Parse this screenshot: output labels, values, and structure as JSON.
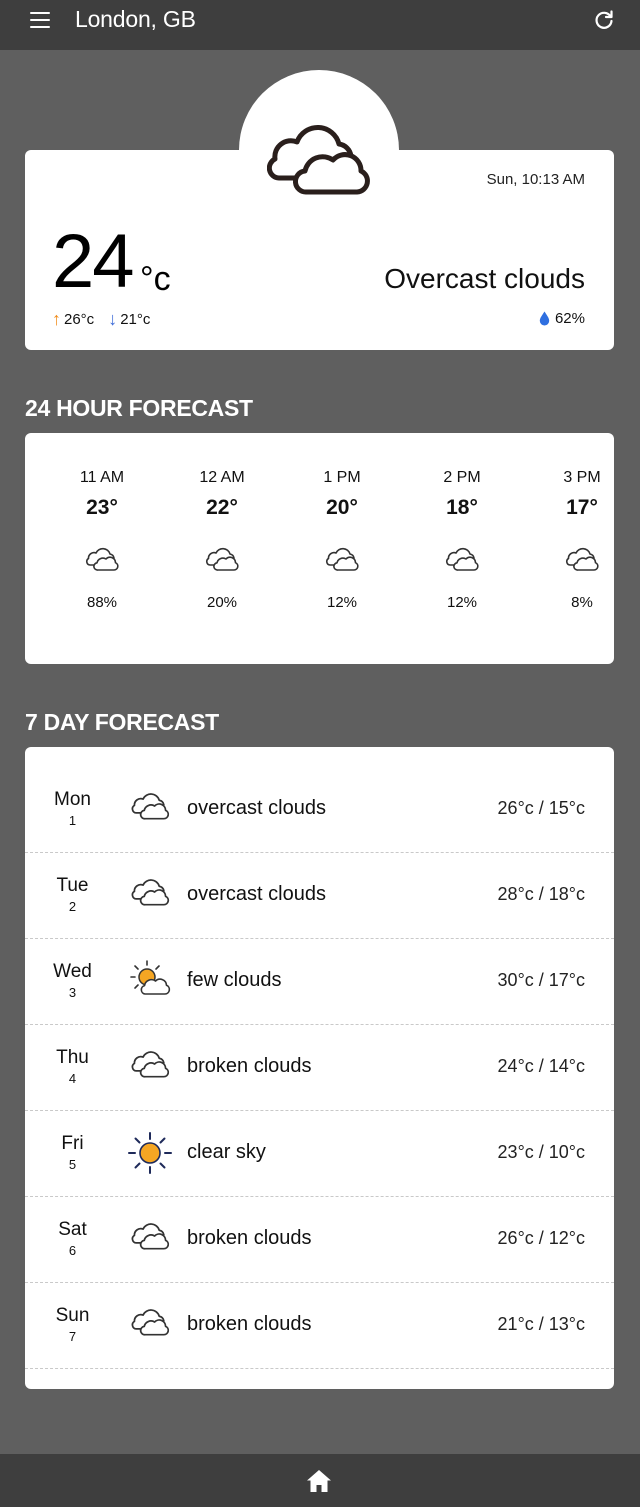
{
  "header": {
    "city": "London, GB",
    "menu_icon": "hamburger-menu-icon",
    "refresh_icon": "refresh-icon"
  },
  "current": {
    "icon": "overcast-clouds-icon",
    "datetime": "Sun, 10:13 AM",
    "temp": "24",
    "unit": "°c",
    "high": "26°c",
    "low": "21°c",
    "description": "Overcast clouds",
    "humidity": "62%",
    "colors": {
      "high_arrow": "#f08c1a",
      "low_arrow": "#3c6bd8",
      "humidity_drop": "#2f6fe0"
    }
  },
  "hourly": {
    "title": "24 HOUR FORECAST",
    "items": [
      {
        "time": "11 AM",
        "temp": "23°",
        "icon": "cloud-icon",
        "pop": "88%"
      },
      {
        "time": "12 AM",
        "temp": "22°",
        "icon": "cloud-icon",
        "pop": "20%"
      },
      {
        "time": "1 PM",
        "temp": "20°",
        "icon": "cloud-icon",
        "pop": "12%"
      },
      {
        "time": "2 PM",
        "temp": "18°",
        "icon": "cloud-icon",
        "pop": "12%"
      },
      {
        "time": "3 PM",
        "temp": "17°",
        "icon": "cloud-icon",
        "pop": "8%"
      }
    ]
  },
  "daily": {
    "title": "7 DAY FORECAST",
    "items": [
      {
        "day": "Mon",
        "date": "1",
        "icon": "cloud-icon",
        "desc": "overcast clouds",
        "range": "26°c / 15°c"
      },
      {
        "day": "Tue",
        "date": "2",
        "icon": "cloud-icon",
        "desc": "overcast clouds",
        "range": "28°c / 18°c"
      },
      {
        "day": "Wed",
        "date": "3",
        "icon": "sun-cloud-icon",
        "desc": "few clouds",
        "range": "30°c / 17°c"
      },
      {
        "day": "Thu",
        "date": "4",
        "icon": "cloud-icon",
        "desc": "broken clouds",
        "range": "24°c / 14°c"
      },
      {
        "day": "Fri",
        "date": "5",
        "icon": "sun-icon",
        "desc": "clear sky",
        "range": "23°c / 10°c"
      },
      {
        "day": "Sat",
        "date": "6",
        "icon": "cloud-icon",
        "desc": "broken clouds",
        "range": "26°c / 12°c"
      },
      {
        "day": "Sun",
        "date": "7",
        "icon": "cloud-icon",
        "desc": "broken clouds",
        "range": "21°c / 13°c"
      }
    ]
  },
  "footer": {
    "home_icon": "home-icon"
  }
}
